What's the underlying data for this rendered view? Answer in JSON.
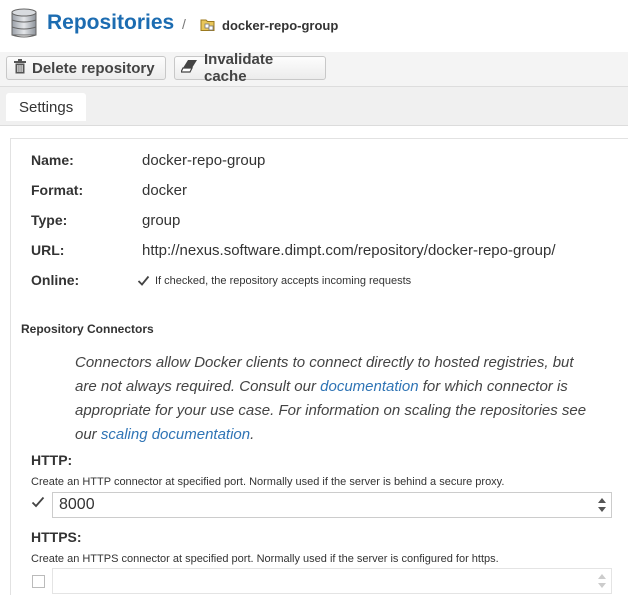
{
  "header": {
    "title": "Repositories",
    "separator": "/",
    "breadcrumb": "docker-repo-group",
    "icons": [
      "database-icon",
      "folder-icon"
    ]
  },
  "toolbar": {
    "delete_label": "Delete repository",
    "invalidate_label": "Invalidate cache"
  },
  "tabs": [
    {
      "label": "Settings",
      "active": true
    }
  ],
  "settings": {
    "name_label": "Name:",
    "name_value": "docker-repo-group",
    "format_label": "Format:",
    "format_value": "docker",
    "type_label": "Type:",
    "type_value": "group",
    "url_label": "URL:",
    "url_value": "http://nexus.software.dimpt.com/repository/docker-repo-group/",
    "online_label": "Online:",
    "online_checked": true,
    "online_help": "If checked, the repository accepts incoming requests"
  },
  "connectors": {
    "section_title": "Repository Connectors",
    "para_1": "Connectors allow Docker clients to connect directly to hosted registries, but are not always required. Consult our",
    "link_1": "documentation",
    "para_2": "for which connector is appropriate for your use case. For information on scaling the repositories see our",
    "link_2": "scaling documentation",
    "para_3": ".",
    "http_label": "HTTP:",
    "http_help": "Create an HTTP connector at specified port. Normally used if the server is behind a secure proxy.",
    "http_checked": true,
    "http_port": "8000",
    "https_label": "HTTPS:",
    "https_help": "Create an HTTPS connector at specified port. Normally used if the server is configured for https.",
    "https_checked": false,
    "https_port": ""
  },
  "colors": {
    "accent": "#1c6cb1",
    "link": "#2f74b5"
  }
}
